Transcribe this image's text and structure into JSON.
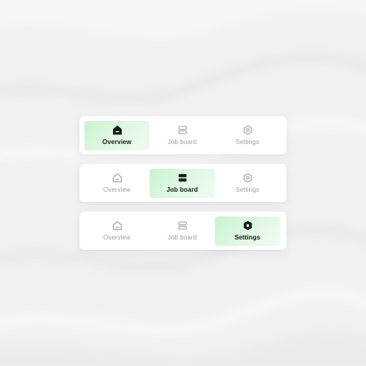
{
  "colors": {
    "background": "#f1f1f2",
    "card": "#ffffff",
    "active_tab_gradient_start": "#c9f3cf",
    "active_tab_gradient_end": "#effbf1",
    "active_text": "#17181a",
    "inactive_text": "#9d9ea3"
  },
  "tab_bars": [
    {
      "active_tab": "Overview",
      "tabs": [
        {
          "label": "Overview",
          "icon": "home-icon",
          "active": true
        },
        {
          "label": "Job board",
          "icon": "stack-icon",
          "active": false
        },
        {
          "label": "Settings",
          "icon": "gear-icon",
          "active": false
        }
      ]
    },
    {
      "active_tab": "Job board",
      "tabs": [
        {
          "label": "Overview",
          "icon": "home-icon",
          "active": false
        },
        {
          "label": "Job board",
          "icon": "stack-icon",
          "active": true
        },
        {
          "label": "Settings",
          "icon": "gear-icon",
          "active": false
        }
      ]
    },
    {
      "active_tab": "Settings",
      "tabs": [
        {
          "label": "Overview",
          "icon": "home-icon",
          "active": false
        },
        {
          "label": "Job board",
          "icon": "stack-icon",
          "active": false
        },
        {
          "label": "Settings",
          "icon": "gear-icon",
          "active": true
        }
      ]
    }
  ]
}
